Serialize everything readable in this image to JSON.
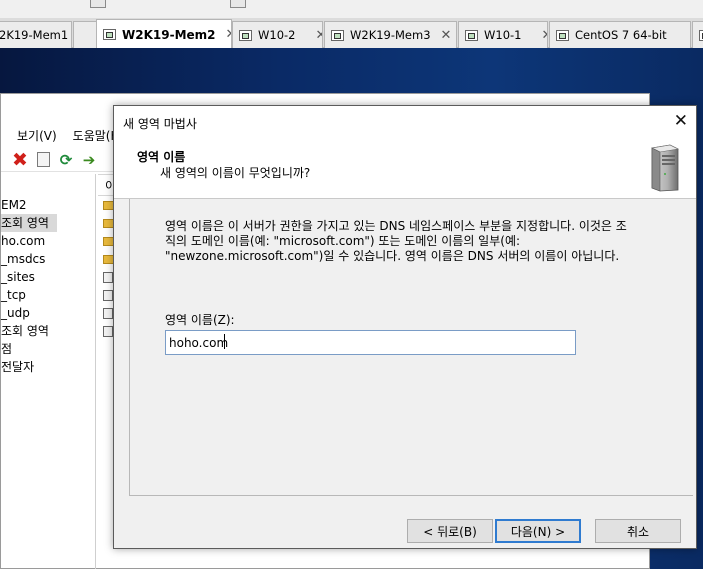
{
  "tabs": [
    {
      "label": "2K19-Mem1",
      "active": false
    },
    {
      "label": "W2K19-Mem2",
      "active": true
    },
    {
      "label": "W10-2",
      "active": false
    },
    {
      "label": "W2K19-Mem3",
      "active": false
    },
    {
      "label": "W10-1",
      "active": false
    },
    {
      "label": "CentOS 7 64-bit",
      "active": false
    }
  ],
  "dns_manager": {
    "menu": [
      "보기(V)",
      "도움말(H)"
    ],
    "tree": [
      "EM2",
      "조회 영역",
      "ho.com",
      "_msdcs",
      "_sites",
      "_tcp",
      "_udp",
      "조회 영역",
      "점",
      "전달자"
    ],
    "list_header": "이"
  },
  "wizard": {
    "title": "새 영역 마법사",
    "heading": "영역 이름",
    "subheading": "새 영역의 이름이 무엇입니까?",
    "description_lines": [
      "영역 이름은 이 서버가 권한을 가지고 있는 DNS 네임스페이스 부분을 지정합니다. 이것은 조",
      "직의 도메인 이름(예: \"microsoft.com\") 또는 도메인 이름의 일부(예:",
      "\"newzone.microsoft.com\")일 수 있습니다. 영역 이름은 DNS 서버의 이름이 아닙니다."
    ],
    "zone_label": "영역 이름(Z):",
    "zone_value": "hoho.com",
    "buttons": {
      "back": "< 뒤로(B)",
      "next": "다음(N) >",
      "cancel": "취소"
    }
  }
}
